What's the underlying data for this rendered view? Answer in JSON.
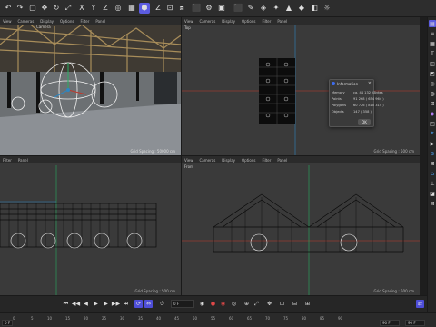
{
  "menu": {
    "view": "View",
    "cameras": "Cameras",
    "display": "Display",
    "options": "Options",
    "filter": "Filter",
    "panel": "Panel"
  },
  "viewports": {
    "perspective": {
      "camera_label": "Camera",
      "grid_spacing": "Grid Spacing : 50000 cm"
    },
    "top": {
      "label": "Top",
      "grid_spacing": "Grid Spacing : 500 cm"
    },
    "right": {
      "grid_spacing": "Grid Spacing : 500 cm"
    },
    "front": {
      "label": "Front",
      "grid_spacing": "Grid Spacing : 500 cm"
    }
  },
  "dialog": {
    "title": "Information",
    "rows": [
      {
        "label": "Memory",
        "value": "ca. 44 132 KBytes"
      },
      {
        "label": "Points",
        "value": "91 268 ( 654 964 )"
      },
      {
        "label": "Polygons",
        "value": "60 726 ( 810 314 )"
      },
      {
        "label": "Objects",
        "value": "147 ( 358 )"
      }
    ],
    "ok": "OK"
  },
  "timeline": {
    "frame": "0 F"
  },
  "ruler": {
    "ticks": [
      "0",
      "5",
      "10",
      "15",
      "20",
      "25",
      "30",
      "35",
      "40",
      "45",
      "50",
      "55",
      "60",
      "65",
      "70",
      "75",
      "80",
      "85",
      "90"
    ],
    "start": "0 F",
    "end_a": "90 F",
    "end_b": "90 F"
  },
  "colors": {
    "accent": "#5c5ce0",
    "axis_red": "#c0392b",
    "axis_green": "#27ae60",
    "axis_blue": "#2e86c1",
    "dialog_logo": "#3d6cf0"
  }
}
